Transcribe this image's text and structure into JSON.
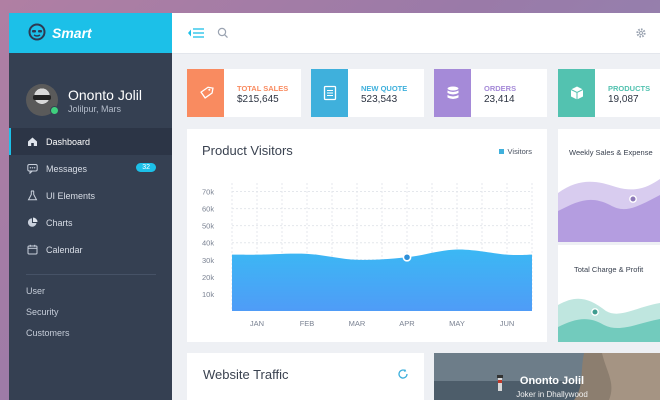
{
  "brand": {
    "name": "Smart"
  },
  "profile": {
    "name": "Ononto Jolil",
    "location": "Jolilpur, Mars"
  },
  "nav": [
    {
      "label": "Dashboard",
      "icon": "home-icon",
      "active": true
    },
    {
      "label": "Messages",
      "icon": "messages-icon",
      "badge": "32"
    },
    {
      "label": "UI Elements",
      "icon": "flask-icon"
    },
    {
      "label": "Charts",
      "icon": "pie-chart-icon"
    },
    {
      "label": "Calendar",
      "icon": "calendar-icon"
    }
  ],
  "subnav": [
    {
      "label": "User"
    },
    {
      "label": "Security"
    },
    {
      "label": "Customers"
    }
  ],
  "stats": [
    {
      "title": "TOTAL SALES",
      "value": "$215,645",
      "color": "#f98b60",
      "icon": "price-tag-icon"
    },
    {
      "title": "NEW QUOTE",
      "value": "523,543",
      "color": "#3fb0dc",
      "icon": "document-icon"
    },
    {
      "title": "ORDERS",
      "value": "23,414",
      "color": "#a58ad8",
      "icon": "database-icon"
    },
    {
      "title": "PRODUCTS",
      "value": "19,087",
      "color": "#53c2b0",
      "icon": "cube-icon"
    }
  ],
  "visitors_panel": {
    "title": "Product Visitors",
    "legend": "Visitors"
  },
  "chart_data": {
    "type": "area",
    "title": "Product Visitors",
    "categories": [
      "JAN",
      "FEB",
      "MAR",
      "APR",
      "MAY",
      "JUN"
    ],
    "y_ticks": [
      "70k",
      "60k",
      "50k",
      "40k",
      "30k",
      "20k",
      "10k"
    ],
    "ylim": [
      0,
      75000
    ],
    "series": [
      {
        "name": "Visitors",
        "values": [
          33000,
          33500,
          30000,
          31500,
          36000,
          33000
        ],
        "color": "#3da5f5"
      }
    ],
    "highlight": {
      "category": "APR"
    },
    "grid": true,
    "legend": "top-right"
  },
  "weekly_panel": {
    "title": "Weekly Sales & Expense"
  },
  "charge_panel": {
    "title": "Total Charge & Profit"
  },
  "traffic_panel": {
    "title": "Website Traffic"
  },
  "profile_card": {
    "name": "Ononto Jolil",
    "subtitle": "Joker in Dhallywood"
  },
  "colors": {
    "accent": "#1cc0e8",
    "sidebar": "#354052"
  }
}
